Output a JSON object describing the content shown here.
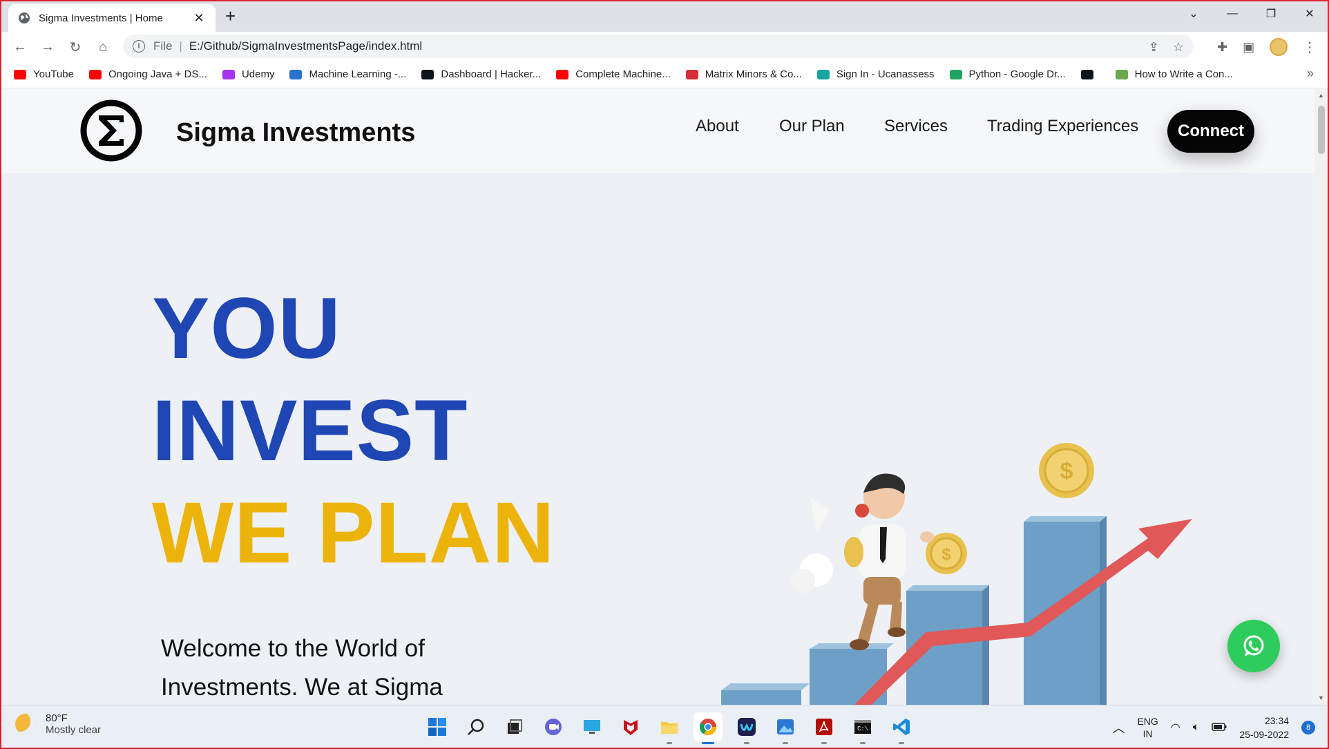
{
  "browser": {
    "tab_title": "Sigma Investments | Home",
    "tab_close": "✕",
    "new_tab": "+",
    "address_scheme": "File",
    "address_url": "E:/Github/SigmaInvestmentsPage/index.html",
    "bookmarks": [
      {
        "label": "YouTube",
        "icon": "youtube-icon",
        "color": "#ff0000"
      },
      {
        "label": "Ongoing Java + DS...",
        "icon": "youtube-icon",
        "color": "#ff0000"
      },
      {
        "label": "Udemy",
        "icon": "udemy-icon",
        "color": "#a435f0"
      },
      {
        "label": "Machine Learning -...",
        "icon": "coursera-icon",
        "color": "#2a73cc"
      },
      {
        "label": "Dashboard | Hacker...",
        "icon": "hackerrank-icon",
        "color": "#0e141e"
      },
      {
        "label": "Complete Machine...",
        "icon": "youtube-icon",
        "color": "#ff0000"
      },
      {
        "label": "Matrix Minors & Co...",
        "icon": "sy-icon",
        "color": "#d62d3a"
      },
      {
        "label": "Sign In - Ucanassess",
        "icon": "ucanassess-icon",
        "color": "#1aa3a3"
      },
      {
        "label": "Python - Google Dr...",
        "icon": "google-drive-icon",
        "color": "#1fa463"
      },
      {
        "label": "",
        "icon": "hackerrank-icon",
        "color": "#0e141e"
      },
      {
        "label": "How to Write a Con...",
        "icon": "wh-icon",
        "color": "#6aa84f"
      }
    ],
    "bookmarks_more": "»"
  },
  "site": {
    "brand": "Sigma Investments",
    "nav": [
      "About",
      "Our Plan",
      "Services",
      "Trading Experiences"
    ],
    "connect": "Connect",
    "hero": [
      "YOU",
      "INVEST",
      "WE PLAN"
    ],
    "welcome": "Welcome to the World of Investments. We at Sigma",
    "colors": {
      "blue": "#1f47b4",
      "gold": "#ecb40b",
      "whatsapp": "#2ecc5c"
    }
  },
  "taskbar": {
    "weather_temp": "80°F",
    "weather_cond": "Mostly clear",
    "lang_line1": "ENG",
    "lang_line2": "IN",
    "time": "23:34",
    "date": "25-09-2022",
    "notifications": "8",
    "apps": [
      "start-icon",
      "search-icon",
      "task-view-icon",
      "chat-icon",
      "desktop-icon",
      "mcafee-icon",
      "file-explorer-icon",
      "chrome-icon",
      "webex-icon",
      "photos-icon",
      "acrobat-icon",
      "terminal-icon",
      "vscode-icon"
    ]
  }
}
